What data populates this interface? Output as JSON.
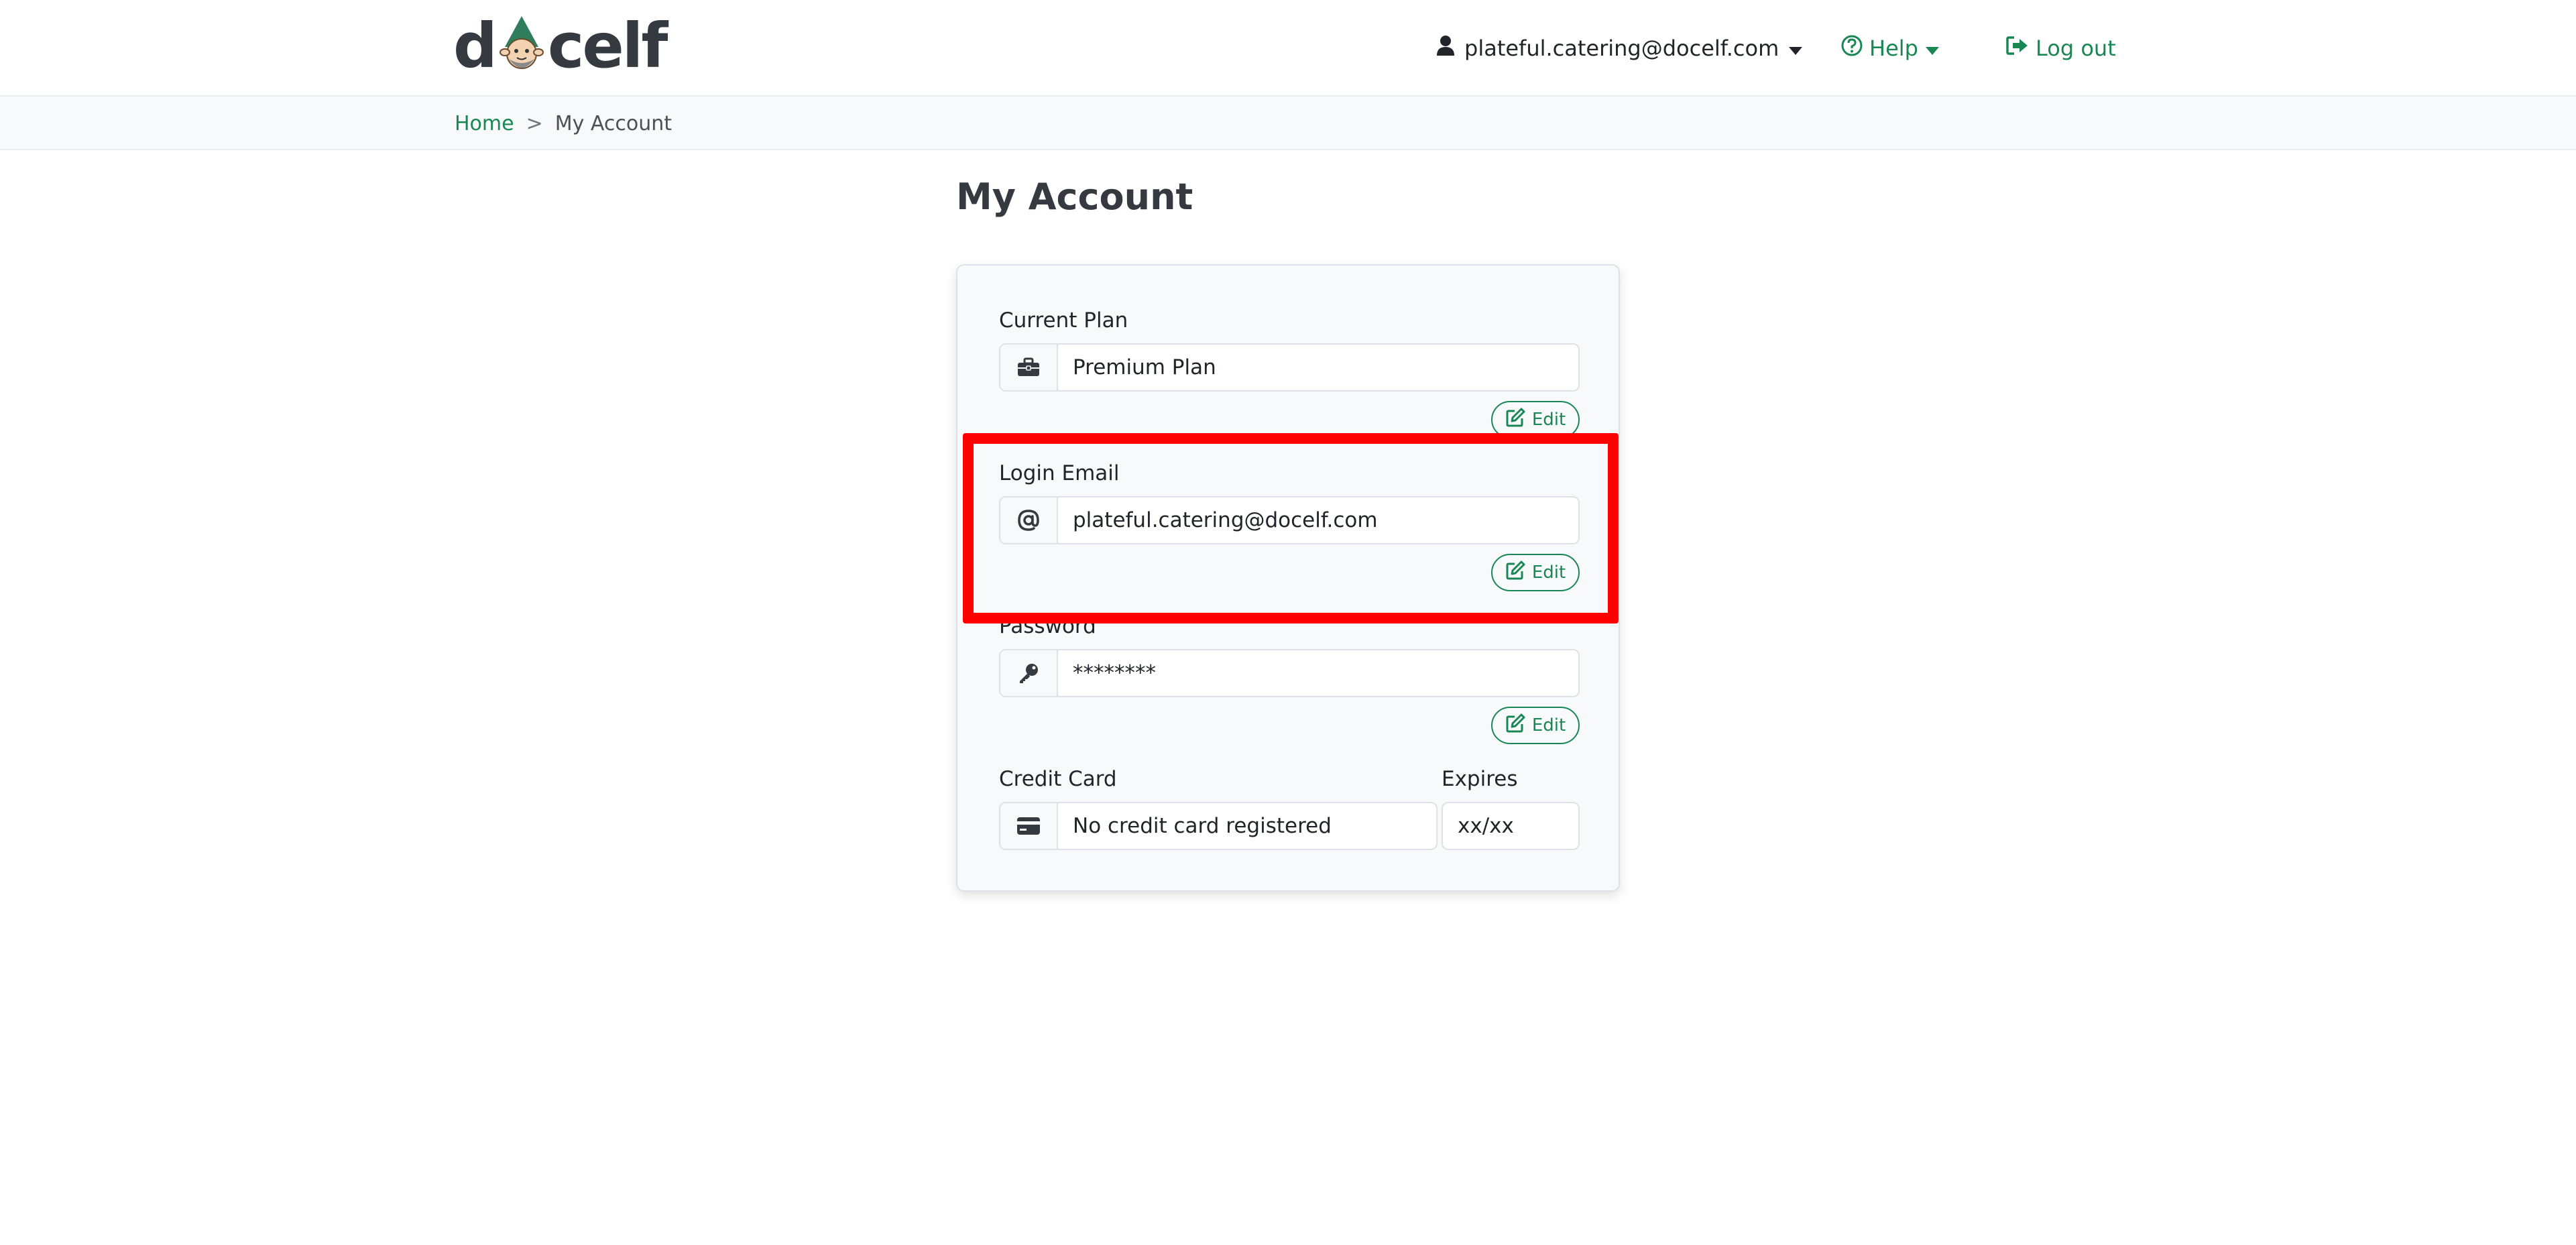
{
  "header": {
    "logo_text_left": "d",
    "logo_text_right": "celf",
    "user_email": "plateful.catering@docelf.com",
    "help_label": "Help",
    "logout_label": "Log out"
  },
  "breadcrumb": {
    "home": "Home",
    "separator": ">",
    "current": "My Account"
  },
  "page": {
    "title": "My Account"
  },
  "account": {
    "plan": {
      "label": "Current Plan",
      "value": "Premium Plan",
      "icon": "briefcase-icon",
      "edit_label": "Edit"
    },
    "email": {
      "label": "Login Email",
      "value": "plateful.catering@docelf.com",
      "icon": "at-icon",
      "edit_label": "Edit"
    },
    "password": {
      "label": "Password",
      "value": "********",
      "icon": "key-icon",
      "edit_label": "Edit"
    },
    "credit_card": {
      "label": "Credit Card",
      "value": "No credit card registered",
      "icon": "credit-card-icon",
      "expires_label": "Expires",
      "expires_value": "xx/xx"
    }
  },
  "colors": {
    "accent": "#198754",
    "highlight": "#ff0000",
    "text": "#212529"
  }
}
